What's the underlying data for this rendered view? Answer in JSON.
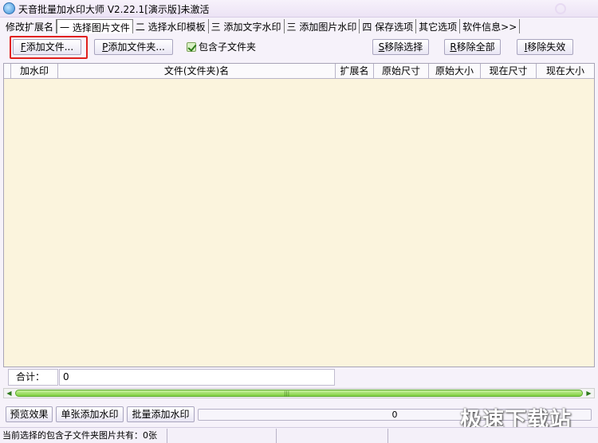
{
  "window": {
    "title": "天音批量加水印大师 V2.22.1[演示版]未激活"
  },
  "tabs": [
    {
      "label": "修改扩展名"
    },
    {
      "label": "一 选择图片文件",
      "active": true
    },
    {
      "label": "二 选择水印模板"
    },
    {
      "label": "三 添加文字水印"
    },
    {
      "label": "三 添加图片水印"
    },
    {
      "label": "四 保存选项"
    },
    {
      "label": "其它选项"
    },
    {
      "label": "软件信息>>"
    }
  ],
  "toolbar": {
    "add_file": {
      "hotkey": "F",
      "label": "添加文件..."
    },
    "add_folder": {
      "hotkey": "P",
      "label": "添加文件夹..."
    },
    "include_subfolders": {
      "label": "包含子文件夹",
      "checked": true
    },
    "remove_selected": {
      "hotkey": "S",
      "label": "移除选择"
    },
    "remove_all": {
      "hotkey": "R",
      "label": "移除全部"
    },
    "remove_invalid": {
      "hotkey": "I",
      "label": "移除失效"
    }
  },
  "grid": {
    "columns": [
      "加水印",
      "文件(文件夹)名",
      "扩展名",
      "原始尺寸",
      "原始大小",
      "现在尺寸",
      "现在大小"
    ],
    "rows": []
  },
  "summary": {
    "label": "合计：",
    "value": "0"
  },
  "bottom": {
    "preview": "预览效果",
    "single": "单张添加水印",
    "batch": "批量添加水印",
    "progress_text": "0",
    "progress_value": 0
  },
  "watermark_text": "极速下载站",
  "status": {
    "left": "当前选择的包含子文件夹图片共有：0张"
  },
  "colors": {
    "grid_bg": "#fbf4dd",
    "highlight": "#e0201d",
    "scroll_thumb": "#7fcf3f"
  },
  "icons": {
    "app": "app-logo-icon",
    "check": "checkmark-icon"
  }
}
